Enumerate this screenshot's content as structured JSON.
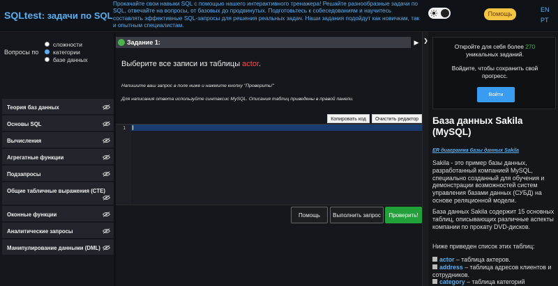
{
  "header": {
    "logo_strong": "SQLtest",
    "logo_rest": ": задачи по SQL",
    "tagline": "Прокачайте свои навыки SQL с помощью нашего интерактивного тренажера! Решайте разнообразные задачи по SQL, отвечайте на вопросы, от базовых до продвинутых. Подготовьтесь к собеседованиям и научитесь составлять эффективные SQL-запросы для решения реальных задач. Наши задания подойдут как новичкам, так и опытным специалистам.",
    "help_label": "Помощь",
    "lang_en": "EN",
    "lang_pt": "PT"
  },
  "sidebar": {
    "questions_by_label": "Вопросы по",
    "radio_options": [
      {
        "label": "сложности",
        "selected": false
      },
      {
        "label": "категории",
        "selected": true
      },
      {
        "label": "базе данных",
        "selected": false
      }
    ],
    "topics": [
      "Теория баз данных",
      "Основы SQL",
      "Вычисления",
      "Агрегатные функции",
      "Подзапросы",
      "Общие табличные выражения (CTE)",
      "Оконные функции",
      "Аналитические запросы",
      "Манипулирование данными (DML)"
    ]
  },
  "task": {
    "header_label": "Задание  1:",
    "question_prefix": "Выберите все записи из таблицы",
    "table_name": "actor",
    "question_suffix": ".",
    "hint1": "Напишите ваш запрос в поле ниже и нажмите кнопку \"Проверить!\"",
    "hint2": "Для написания ответа используйте синтаксис MySQL. Описания таблиц приведены в правой панели."
  },
  "editor": {
    "copy_label": "Копировать код",
    "clear_label": "Очистить редактор",
    "line_number": "1"
  },
  "actions": {
    "help_label": "Помощь",
    "run_label": "Выполнить запрос",
    "check_label": "Проверить!"
  },
  "right": {
    "promo_line1_prefix": "Откройте для себя более",
    "promo_count": "270",
    "promo_line2": "уникальных заданий.",
    "promo_line3": "Войдите, чтобы сохранить свой",
    "promo_line4": "прогресс.",
    "login_label": "Войти",
    "db_title": "База данных Sakila (MySQL)",
    "er_link": "ER диаграмма базы данных Sakila",
    "para1": "Sakila - это пример базы данных, разработанный компанией MySQL, специально созданный для обучения и демонстрации возможностей систем управления базами данных (СУБД) на основе реляционной модели.",
    "para2": "База данных Sakila содержит 15 основных таблиц, описывающих различные аспекты компании по прокату DVD-дисков.",
    "para3": "Ниже приведен список этих таблиц:",
    "tables": [
      {
        "name": "actor",
        "desc": " – таблица актеров."
      },
      {
        "name": "address",
        "desc": " – таблица адресов клиентов и сотрудников."
      },
      {
        "name": "category",
        "desc": " – таблица категорий"
      }
    ]
  },
  "colors": {
    "accent": "#5aaef0",
    "green": "#49b44b",
    "danger": "#ff4b4b",
    "help_yellow": "#f4c542"
  }
}
